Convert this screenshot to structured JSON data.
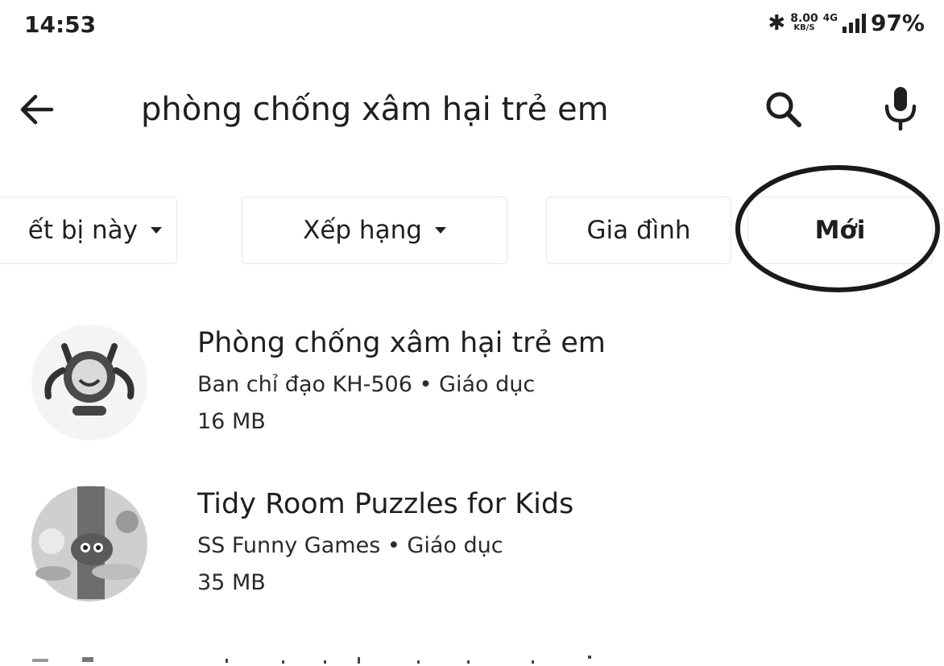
{
  "status_bar": {
    "time": "14:53",
    "net_speed_value": "8.00",
    "net_speed_unit": "KB/S",
    "network_type": "4G",
    "battery": "97%"
  },
  "search": {
    "query": "phòng chống xâm hại trẻ em"
  },
  "chips": [
    {
      "label": "ết bị này",
      "has_dropdown": true
    },
    {
      "label": "Xếp hạng",
      "has_dropdown": true
    },
    {
      "label": "Gia đình",
      "has_dropdown": false
    },
    {
      "label": "Mới",
      "has_dropdown": false,
      "circled": true
    }
  ],
  "results": [
    {
      "name": "Phòng chống xâm hại trẻ em",
      "developer": "Ban chỉ đạo KH-506",
      "category": "Giáo dục",
      "size": "16 MB",
      "icon": "cartoon-character-icon"
    },
    {
      "name": "Tidy Room Puzzles for Kids",
      "developer": "SS Funny Games",
      "category": "Giáo dục",
      "size": "35 MB",
      "icon": "puzzle-game-icon"
    }
  ],
  "separator": "•",
  "colors": {
    "text": "#1f1f1f",
    "background": "#ffffff",
    "annotation_circle": "#1a1a1a"
  }
}
